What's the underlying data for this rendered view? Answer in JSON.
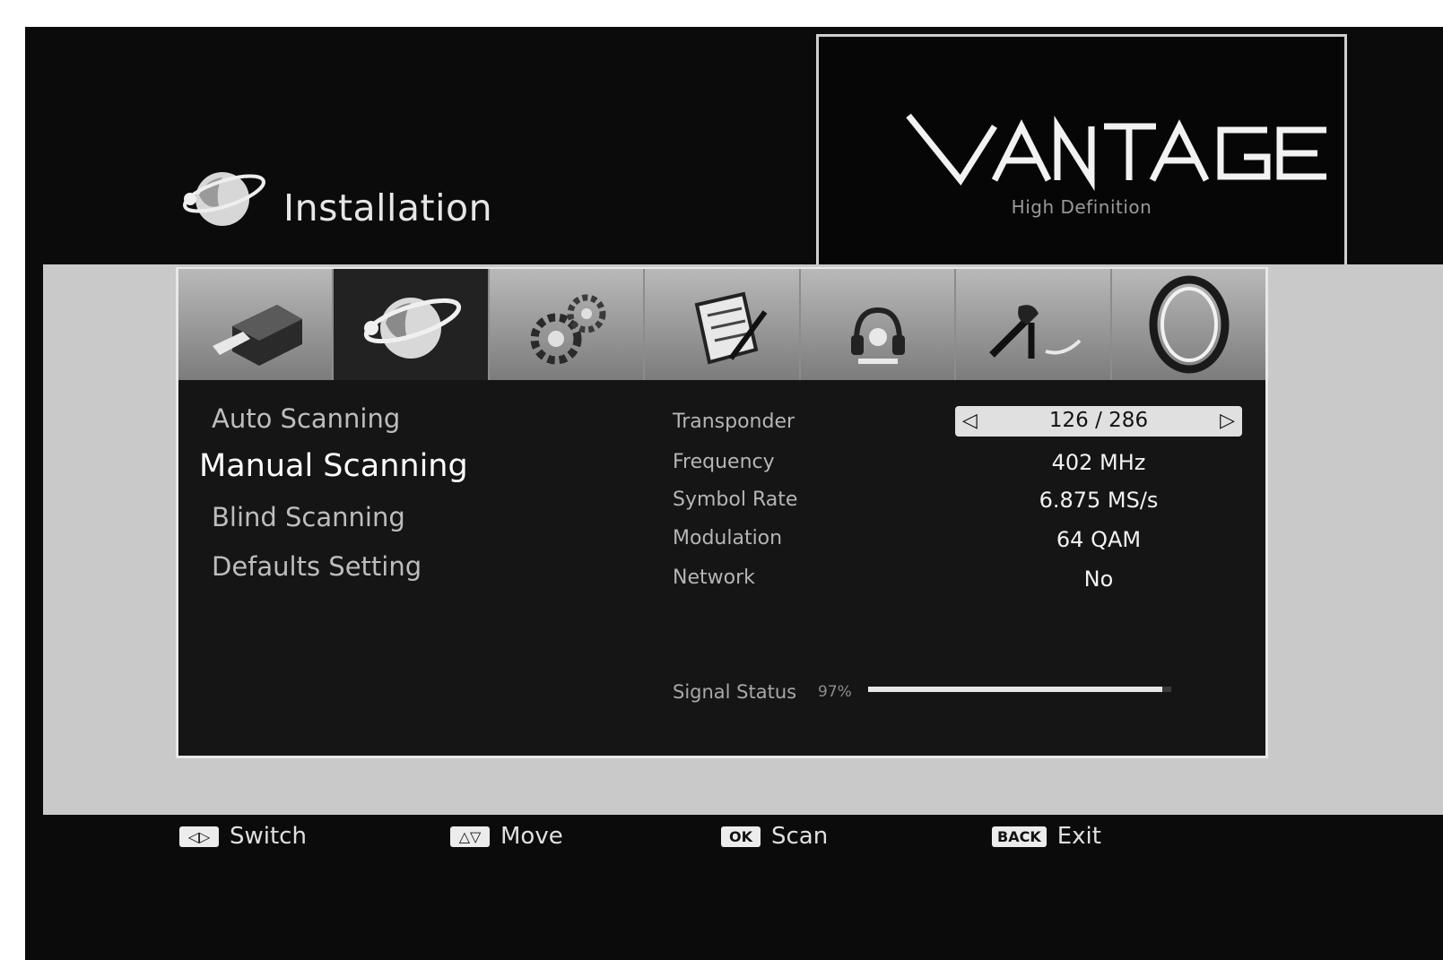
{
  "header": {
    "title": "Installation",
    "icon": "satellite-globe-icon"
  },
  "brand": {
    "logo_text": "VANTAGE",
    "subtitle": "High Definition"
  },
  "icon_bar": [
    {
      "icon": "receiver-icon",
      "active": false
    },
    {
      "icon": "satellite-globe-icon",
      "active": true
    },
    {
      "icon": "gears-icon",
      "active": false
    },
    {
      "icon": "notepad-icon",
      "active": false
    },
    {
      "icon": "headphones-icon",
      "active": false
    },
    {
      "icon": "tools-icon",
      "active": false
    },
    {
      "icon": "oval-icon",
      "active": false
    }
  ],
  "menu": {
    "items": [
      {
        "label": "Auto Scanning",
        "selected": false
      },
      {
        "label": "Manual Scanning",
        "selected": true
      },
      {
        "label": "Blind Scanning",
        "selected": false
      },
      {
        "label": "Defaults Setting",
        "selected": false
      }
    ]
  },
  "fields": {
    "transponder": {
      "label": "Transponder",
      "value": "126 / 286"
    },
    "frequency": {
      "label": "Frequency",
      "value": "402 MHz"
    },
    "symbol_rate": {
      "label": "Symbol Rate",
      "value": "6.875 MS/s"
    },
    "modulation": {
      "label": "Modulation",
      "value": "64 QAM"
    },
    "network": {
      "label": "Network",
      "value": "No"
    }
  },
  "signal": {
    "label": "Signal Status",
    "percent_text": "97%",
    "level": 0.97
  },
  "footer": [
    {
      "key": "◁▷",
      "label": "Switch"
    },
    {
      "key": "△▽",
      "label": "Move"
    },
    {
      "key": "OK",
      "label": "Scan"
    },
    {
      "key": "BACK",
      "label": "Exit"
    }
  ],
  "colors": {
    "screen_bg": "#0b0b0b",
    "band_bg": "#c9c9c9",
    "panel_bg": "#151515",
    "accent": "#e8e8e8"
  }
}
